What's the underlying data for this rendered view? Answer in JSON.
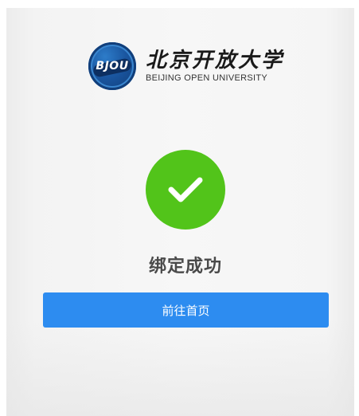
{
  "brand": {
    "badge_text": "BJOU",
    "name_cn": "北京开放大学",
    "name_en": "BEIJING OPEN UNIVERSITY"
  },
  "status": {
    "icon": "checkmark-icon",
    "color": "#52c41a",
    "title": "绑定成功"
  },
  "actions": {
    "home_label": "前往首页",
    "home_color": "#2d8cf0"
  }
}
